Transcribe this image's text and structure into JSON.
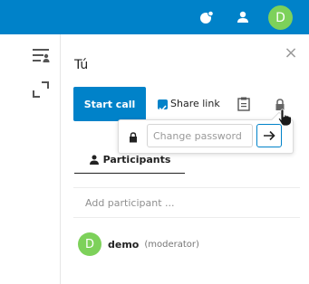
{
  "header": {
    "avatar_initial": "D",
    "accent": "#0082c9",
    "avatar_color": "#7dd15a",
    "icons": [
      "notifications-icon",
      "contacts-icon"
    ]
  },
  "left_rail": {
    "icons": [
      "filter-list-icon",
      "fullscreen-icon"
    ]
  },
  "sidebar": {
    "close_icon": "close-icon",
    "room_title": "Tú",
    "start_call_label": "Start call",
    "share_link": {
      "label": "Share link",
      "checked": true
    },
    "copy_icon": "clipboard-icon",
    "lock_icon": "lock-icon",
    "password_popover": {
      "placeholder": "Change password",
      "submit_icon": "arrow-right-icon"
    },
    "tabs": [
      {
        "label": "Participants",
        "icon": "participants-icon",
        "active": true
      }
    ],
    "add_participant_placeholder": "Add participant ...",
    "participants": [
      {
        "initial": "D",
        "name": "demo",
        "role": "(moderator)"
      }
    ]
  }
}
